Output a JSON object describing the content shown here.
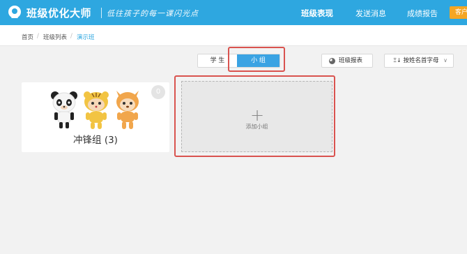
{
  "header": {
    "app_title": "班级优化大师",
    "slogan": "低往孩子的每一课闪光点",
    "nav": [
      "班级表现",
      "发送消息",
      "成绩报告"
    ],
    "client_label": "客户",
    "colors": {
      "bar": "#2ea7e0",
      "client": "#f5a623"
    }
  },
  "breadcrumb": [
    "首页",
    "班级列表",
    "演示班"
  ],
  "toolbar": {
    "tab_student": "学 生",
    "tab_group": "小 组",
    "report_button": "班级报表",
    "sort_select": "按姓名首字母"
  },
  "groups": [
    {
      "name": "冲锋组 (3)",
      "badge": "0",
      "members": [
        "panda-avatar",
        "tiger-avatar",
        "deer-avatar"
      ]
    }
  ],
  "add_group": {
    "label": "添加小组"
  },
  "highlight_color": "#d9534f"
}
